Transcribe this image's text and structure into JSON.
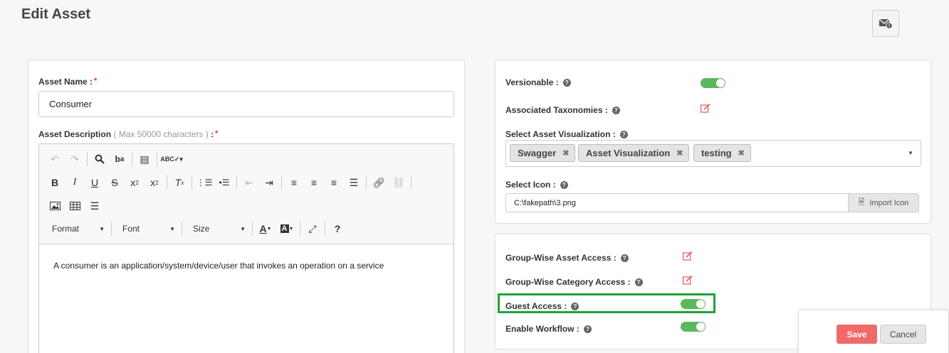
{
  "page": {
    "title": "Edit Asset"
  },
  "header": {
    "notification_icon": "mail-alert-icon"
  },
  "asset_name": {
    "label": "Asset Name :",
    "required": "*",
    "value": "Consumer"
  },
  "asset_description": {
    "label": "Asset Description",
    "hint": "( Max 50000 characters )",
    "suffix": " :",
    "required": "*",
    "toolbar": {
      "format": "Format",
      "font": "Font",
      "size": "Size"
    },
    "content": "A consumer is an application/system/device/user that invokes an operation on a service"
  },
  "right_panel": {
    "versionable": {
      "label": "Versionable :",
      "enabled": true
    },
    "associated_taxonomies": {
      "label": "Associated Taxonomies :"
    },
    "asset_visualization": {
      "label": "Select Asset Visualization :",
      "tags": [
        "Swagger",
        "Asset Visualization",
        "testing"
      ]
    },
    "select_icon": {
      "label": "Select Icon :",
      "value": "C:\\fakepath\\3.png",
      "button": "Import Icon"
    }
  },
  "access_panel": {
    "group_asset_access": {
      "label": "Group-Wise Asset Access :"
    },
    "group_category_access": {
      "label": "Group-Wise Category Access :"
    },
    "guest_access": {
      "label": "Guest Access :",
      "enabled": true
    },
    "enable_workflow": {
      "label": "Enable Workflow :",
      "enabled": true
    }
  },
  "actions": {
    "save": "Save",
    "cancel": "Cancel"
  },
  "colors": {
    "accent_green": "#5cb85c",
    "save_red": "#f06a6a",
    "edit_red": "#e55555",
    "highlight": "#1fa33a"
  }
}
